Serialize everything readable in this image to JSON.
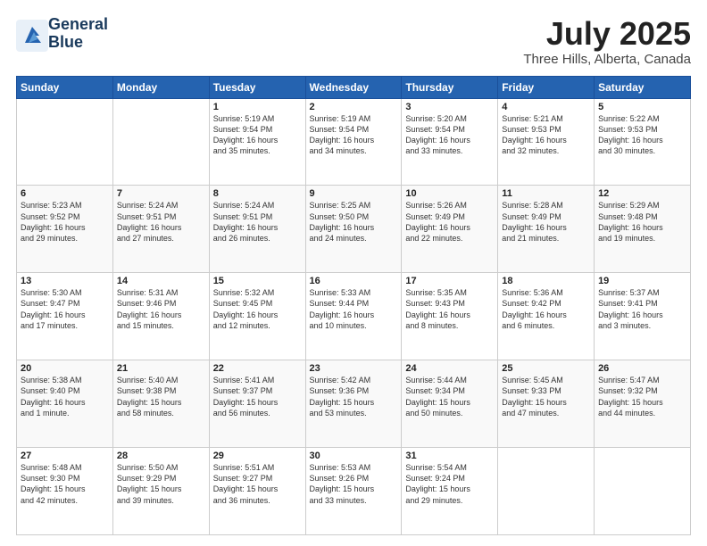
{
  "logo": {
    "line1": "General",
    "line2": "Blue"
  },
  "title": "July 2025",
  "location": "Three Hills, Alberta, Canada",
  "days_header": [
    "Sunday",
    "Monday",
    "Tuesday",
    "Wednesday",
    "Thursday",
    "Friday",
    "Saturday"
  ],
  "weeks": [
    [
      {
        "num": "",
        "info": ""
      },
      {
        "num": "",
        "info": ""
      },
      {
        "num": "1",
        "info": "Sunrise: 5:19 AM\nSunset: 9:54 PM\nDaylight: 16 hours\nand 35 minutes."
      },
      {
        "num": "2",
        "info": "Sunrise: 5:19 AM\nSunset: 9:54 PM\nDaylight: 16 hours\nand 34 minutes."
      },
      {
        "num": "3",
        "info": "Sunrise: 5:20 AM\nSunset: 9:54 PM\nDaylight: 16 hours\nand 33 minutes."
      },
      {
        "num": "4",
        "info": "Sunrise: 5:21 AM\nSunset: 9:53 PM\nDaylight: 16 hours\nand 32 minutes."
      },
      {
        "num": "5",
        "info": "Sunrise: 5:22 AM\nSunset: 9:53 PM\nDaylight: 16 hours\nand 30 minutes."
      }
    ],
    [
      {
        "num": "6",
        "info": "Sunrise: 5:23 AM\nSunset: 9:52 PM\nDaylight: 16 hours\nand 29 minutes."
      },
      {
        "num": "7",
        "info": "Sunrise: 5:24 AM\nSunset: 9:51 PM\nDaylight: 16 hours\nand 27 minutes."
      },
      {
        "num": "8",
        "info": "Sunrise: 5:24 AM\nSunset: 9:51 PM\nDaylight: 16 hours\nand 26 minutes."
      },
      {
        "num": "9",
        "info": "Sunrise: 5:25 AM\nSunset: 9:50 PM\nDaylight: 16 hours\nand 24 minutes."
      },
      {
        "num": "10",
        "info": "Sunrise: 5:26 AM\nSunset: 9:49 PM\nDaylight: 16 hours\nand 22 minutes."
      },
      {
        "num": "11",
        "info": "Sunrise: 5:28 AM\nSunset: 9:49 PM\nDaylight: 16 hours\nand 21 minutes."
      },
      {
        "num": "12",
        "info": "Sunrise: 5:29 AM\nSunset: 9:48 PM\nDaylight: 16 hours\nand 19 minutes."
      }
    ],
    [
      {
        "num": "13",
        "info": "Sunrise: 5:30 AM\nSunset: 9:47 PM\nDaylight: 16 hours\nand 17 minutes."
      },
      {
        "num": "14",
        "info": "Sunrise: 5:31 AM\nSunset: 9:46 PM\nDaylight: 16 hours\nand 15 minutes."
      },
      {
        "num": "15",
        "info": "Sunrise: 5:32 AM\nSunset: 9:45 PM\nDaylight: 16 hours\nand 12 minutes."
      },
      {
        "num": "16",
        "info": "Sunrise: 5:33 AM\nSunset: 9:44 PM\nDaylight: 16 hours\nand 10 minutes."
      },
      {
        "num": "17",
        "info": "Sunrise: 5:35 AM\nSunset: 9:43 PM\nDaylight: 16 hours\nand 8 minutes."
      },
      {
        "num": "18",
        "info": "Sunrise: 5:36 AM\nSunset: 9:42 PM\nDaylight: 16 hours\nand 6 minutes."
      },
      {
        "num": "19",
        "info": "Sunrise: 5:37 AM\nSunset: 9:41 PM\nDaylight: 16 hours\nand 3 minutes."
      }
    ],
    [
      {
        "num": "20",
        "info": "Sunrise: 5:38 AM\nSunset: 9:40 PM\nDaylight: 16 hours\nand 1 minute."
      },
      {
        "num": "21",
        "info": "Sunrise: 5:40 AM\nSunset: 9:38 PM\nDaylight: 15 hours\nand 58 minutes."
      },
      {
        "num": "22",
        "info": "Sunrise: 5:41 AM\nSunset: 9:37 PM\nDaylight: 15 hours\nand 56 minutes."
      },
      {
        "num": "23",
        "info": "Sunrise: 5:42 AM\nSunset: 9:36 PM\nDaylight: 15 hours\nand 53 minutes."
      },
      {
        "num": "24",
        "info": "Sunrise: 5:44 AM\nSunset: 9:34 PM\nDaylight: 15 hours\nand 50 minutes."
      },
      {
        "num": "25",
        "info": "Sunrise: 5:45 AM\nSunset: 9:33 PM\nDaylight: 15 hours\nand 47 minutes."
      },
      {
        "num": "26",
        "info": "Sunrise: 5:47 AM\nSunset: 9:32 PM\nDaylight: 15 hours\nand 44 minutes."
      }
    ],
    [
      {
        "num": "27",
        "info": "Sunrise: 5:48 AM\nSunset: 9:30 PM\nDaylight: 15 hours\nand 42 minutes."
      },
      {
        "num": "28",
        "info": "Sunrise: 5:50 AM\nSunset: 9:29 PM\nDaylight: 15 hours\nand 39 minutes."
      },
      {
        "num": "29",
        "info": "Sunrise: 5:51 AM\nSunset: 9:27 PM\nDaylight: 15 hours\nand 36 minutes."
      },
      {
        "num": "30",
        "info": "Sunrise: 5:53 AM\nSunset: 9:26 PM\nDaylight: 15 hours\nand 33 minutes."
      },
      {
        "num": "31",
        "info": "Sunrise: 5:54 AM\nSunset: 9:24 PM\nDaylight: 15 hours\nand 29 minutes."
      },
      {
        "num": "",
        "info": ""
      },
      {
        "num": "",
        "info": ""
      }
    ]
  ]
}
